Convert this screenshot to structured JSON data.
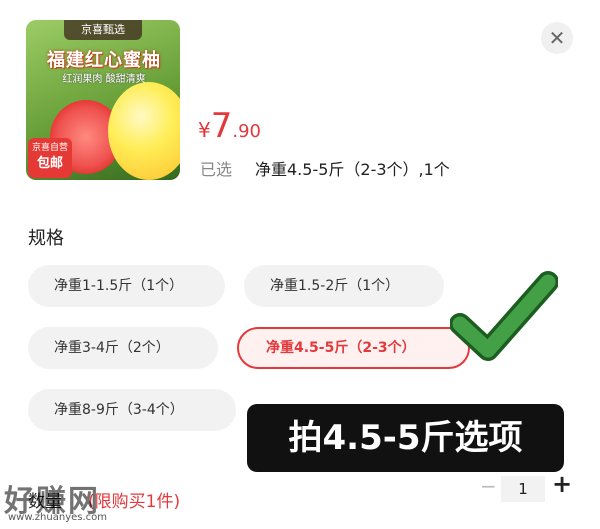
{
  "product": {
    "image_tag": "京喜甄选",
    "image_title": "福建红心蜜柚",
    "image_subtitle": "红润果肉 酸甜清爽",
    "badge_line1": "京喜自营",
    "badge_line2": "包邮"
  },
  "price": {
    "symbol": "¥",
    "integer": "7",
    "decimal": ".90",
    "color": "#e4393c"
  },
  "selected": {
    "label": "已选",
    "value": "净重4.5-5斤（2-3个）,1个"
  },
  "close_icon": "close-icon",
  "specs": {
    "title": "规格",
    "options": [
      {
        "label": "净重1-1.5斤（1个）",
        "selected": false
      },
      {
        "label": "净重1.5-2斤（1个）",
        "selected": false
      },
      {
        "label": "净重3-4斤（2个）",
        "selected": false
      },
      {
        "label": "净重4.5-5斤（2-3个）",
        "selected": true
      },
      {
        "label": "净重8-9斤（3-4个）",
        "selected": false
      }
    ]
  },
  "annotation": {
    "label": "拍4.5-5斤选项",
    "check_icon": "checkmark-icon",
    "check_color": "#43a047"
  },
  "quantity": {
    "label": "数量",
    "limit": "(限购买1件)",
    "value": "1",
    "minus": "−",
    "plus": "+"
  },
  "watermark": {
    "text": "好赚网",
    "url": "www.zhuanyes.com"
  }
}
